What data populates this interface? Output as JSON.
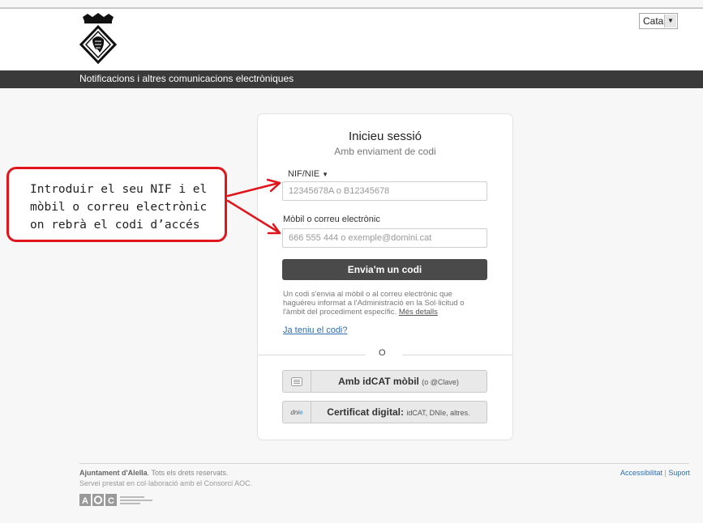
{
  "language": {
    "selected": "Català"
  },
  "navbar": {
    "title": "Notificacions i altres comunicacions electròniques"
  },
  "login": {
    "title": "Inicieu sessió",
    "subtitle": "Amb enviament de codi",
    "id_type_label": "NIF/NIE",
    "id_placeholder": "12345678A o B12345678",
    "contact_label": "Mòbil o correu electrònic",
    "contact_placeholder": "666 555 444 o exemple@domini.cat",
    "send_button": "Envia'm un codi",
    "info_text": "Un codi s'envia al mòbil o al correu electrònic que haguéreu informat a l'Administració en la Sol·licitud o l'àmbit del procediment específic.",
    "info_link": "Més detalls",
    "have_code_link": "Ja teniu el codi?",
    "separator": "O",
    "idcat_button_label": "Amb idCAT mòbil",
    "idcat_button_note": "(o @Clave)",
    "idcat_icon": "chat-bubble-icon",
    "cert_button_label": "Certificat digital:",
    "cert_button_note": "idCAT, DNIe, altres.",
    "cert_icon_text": "dni",
    "cert_icon": "dni-e-icon"
  },
  "footer": {
    "org_name": "Ajuntament d'Alella",
    "rights": ". Tots els drets reservats.",
    "service": "Servei prestat en col·laboració amb el Consorci AOC.",
    "aoc_logo_text": "AOC",
    "aoc_logo_caption": "Consorci Administració Oberta de Catalunya",
    "accessibility_link": "Accessibilitat",
    "divider": "|",
    "support_link": "Suport"
  },
  "callout": {
    "text": "Introduir el seu NIF i el mòbil o correu electrònic on rebrà el codi d’accés",
    "border_color": "#e1151b"
  },
  "colors": {
    "navbar": "#3a3a3a",
    "primary_button": "#4a4a4a",
    "link": "#2d6fb0"
  }
}
